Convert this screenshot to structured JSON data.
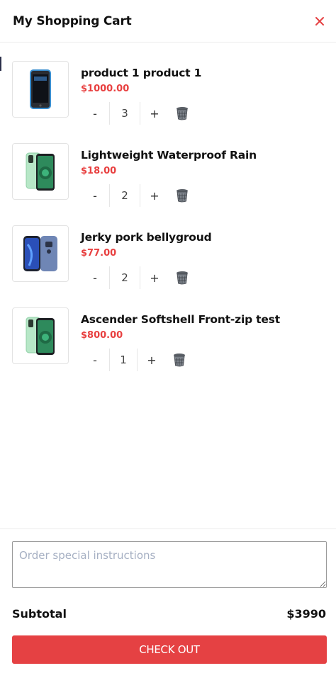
{
  "cart": {
    "title": "My Shopping Cart",
    "close_icon": "close-icon",
    "items": [
      {
        "title": "product 1 product 1",
        "price": "$1000.00",
        "quantity": "3",
        "image": "phone-black-blue"
      },
      {
        "title": "Lightweight Waterproof Rain",
        "price": "$18.00",
        "quantity": "2",
        "image": "phone-green"
      },
      {
        "title": "Jerky pork bellygroud",
        "price": "$77.00",
        "quantity": "2",
        "image": "phone-blue-dual"
      },
      {
        "title": "Ascender Softshell Front-zip test",
        "price": "$800.00",
        "quantity": "1",
        "image": "phone-green"
      }
    ],
    "minus_label": "-",
    "plus_label": "+"
  },
  "footer": {
    "notes_placeholder": "Order special instructions",
    "subtotal_label": "Subtotal",
    "subtotal_value": "$3990",
    "checkout_label": "CHECK OUT"
  },
  "colors": {
    "accent": "#e54143",
    "price": "#e84040"
  }
}
